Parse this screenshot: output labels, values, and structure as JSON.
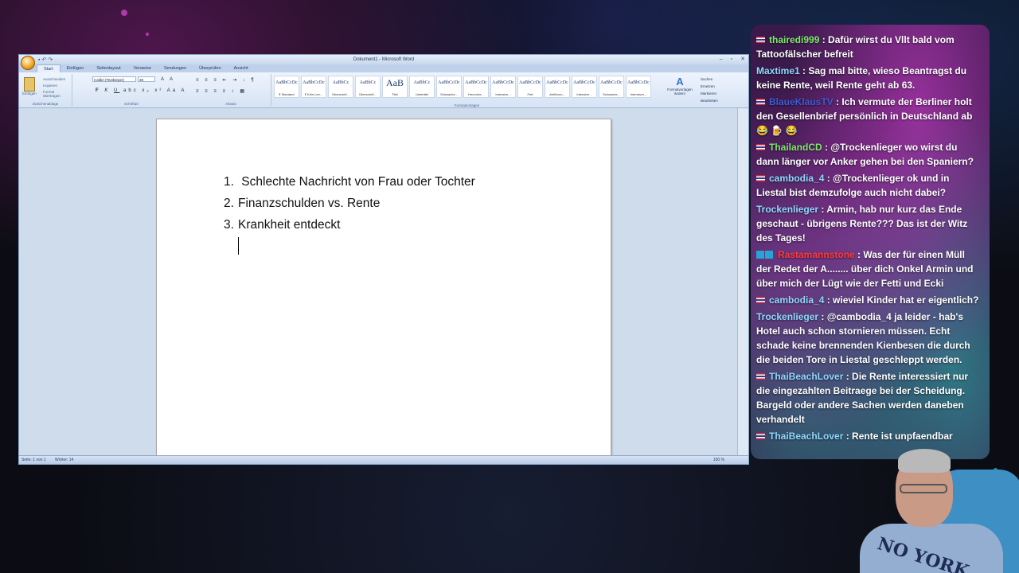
{
  "word": {
    "window_title": "Dokument1 - Microsoft Word",
    "tabs": [
      "Start",
      "Einfügen",
      "Seitenlayout",
      "Verweise",
      "Sendungen",
      "Überprüfen",
      "Ansicht"
    ],
    "clipboard": {
      "paste": "Einfügen",
      "cut": "Ausschneiden",
      "copy": "Kopieren",
      "format_painter": "Format übertragen",
      "group": "Zwischenablage"
    },
    "font": {
      "name": "Calibri (Textkörper)",
      "size": "28",
      "group": "Schriftart"
    },
    "paragraph_group": "Absatz",
    "styles_group": "Formatvorlagen",
    "styles": [
      {
        "preview": "AaBbCcDc",
        "name": "¶ Standard"
      },
      {
        "preview": "AaBbCcDc",
        "name": "¶ Kein Lee..."
      },
      {
        "preview": "AaBbCc",
        "name": "Überschrif..."
      },
      {
        "preview": "AaBbCc",
        "name": "Überschrif..."
      },
      {
        "preview": "AaB",
        "name": "Titel"
      },
      {
        "preview": "AaBbCc",
        "name": "Untertitel"
      },
      {
        "preview": "AaBbCcDc",
        "name": "Schwache..."
      },
      {
        "preview": "AaBbCcDc",
        "name": "Hervorhe..."
      },
      {
        "preview": "AaBbCcDc",
        "name": "Intensive..."
      },
      {
        "preview": "AaBbCcDc",
        "name": "Fett"
      },
      {
        "preview": "AaBbCcDc",
        "name": "Anführun..."
      },
      {
        "preview": "AaBbCcDc",
        "name": "Intensive..."
      },
      {
        "preview": "AaBbCcDc",
        "name": "Schwache..."
      },
      {
        "preview": "AaBbCcDc",
        "name": "Intensiver..."
      }
    ],
    "change_styles": "Formatvorlagen ändern",
    "editing": {
      "find": "Suchen",
      "replace": "Ersetzen",
      "select": "Markieren",
      "group": "Bearbeiten"
    },
    "document": {
      "items": [
        {
          "num": "1.",
          "text": " Schlechte Nachricht von Frau oder Tochter"
        },
        {
          "num": "2.",
          "text": "Finanzschulden vs. Rente"
        },
        {
          "num": "3.",
          "text": "Krankheit entdeckt"
        }
      ]
    },
    "status": {
      "page": "Seite: 1 von 1",
      "words": "Wörter: 14",
      "zoom": "150 %"
    }
  },
  "chat": {
    "messages": [
      {
        "user": "thairedi999",
        "color": "#7de86a",
        "flag": true,
        "text": " : Dafür wirst du Vllt bald vom Tattoofälscher befreit"
      },
      {
        "user": "Maxtime1",
        "color": "#8fd8ff",
        "flag": false,
        "text": " : Sag mal bitte, wieso Beantragst du keine Rente, weil Rente geht ab 63."
      },
      {
        "user": "BlaueKlausTV",
        "color": "#3b5bd9",
        "flag": true,
        "text": " : Ich vermute der Berliner holt den Gesellenbrief persönlich in Deutschland ab 😂 🍺 😂"
      },
      {
        "user": "ThailandCD",
        "color": "#7de86a",
        "flag": true,
        "text": " : @Trockenlieger wo wirst du dann länger vor Anker gehen bei den Spaniern?"
      },
      {
        "user": "cambodia_4",
        "color": "#8fd8ff",
        "flag": true,
        "text": " : @Trockenlieger ok und in Liestal bist demzufolge auch nicht dabei?"
      },
      {
        "user": "Trockenlieger",
        "color": "#8fd8ff",
        "flag": false,
        "text": " : Armin, hab nur kurz das Ende geschaut - übrigens Rente??? Das ist der Witz des Tages!"
      },
      {
        "user": "Rastamannstone",
        "color": "#ff3b3b",
        "flag": false,
        "badges": true,
        "text": " : Was der für einen Müll der Redet der A........ über dich Onkel Armin und über mich der Lügt wie der Fetti und Ecki"
      },
      {
        "user": "cambodia_4",
        "color": "#8fd8ff",
        "flag": true,
        "text": " : wieviel Kinder hat er eigentlich?"
      },
      {
        "user": "Trockenlieger",
        "color": "#8fd8ff",
        "flag": false,
        "text": " : @cambodia_4 ja leider - hab's Hotel auch schon stornieren müssen. Echt schade keine brennenden Kienbesen die durch die beiden Tore in Liestal geschleppt werden."
      },
      {
        "user": "ThaiBeachLover",
        "color": "#8fd8ff",
        "flag": true,
        "text": " : Die Rente interessiert nur die eingezahlten Beitraege bei der Scheidung. Bargeld oder andere Sachen werden daneben verhandelt"
      },
      {
        "user": "ThaiBeachLover",
        "color": "#8fd8ff",
        "flag": true,
        "text": " : Rente ist unpfaendbar"
      }
    ]
  },
  "webcam": {
    "shirt_text": "NO YORK"
  }
}
